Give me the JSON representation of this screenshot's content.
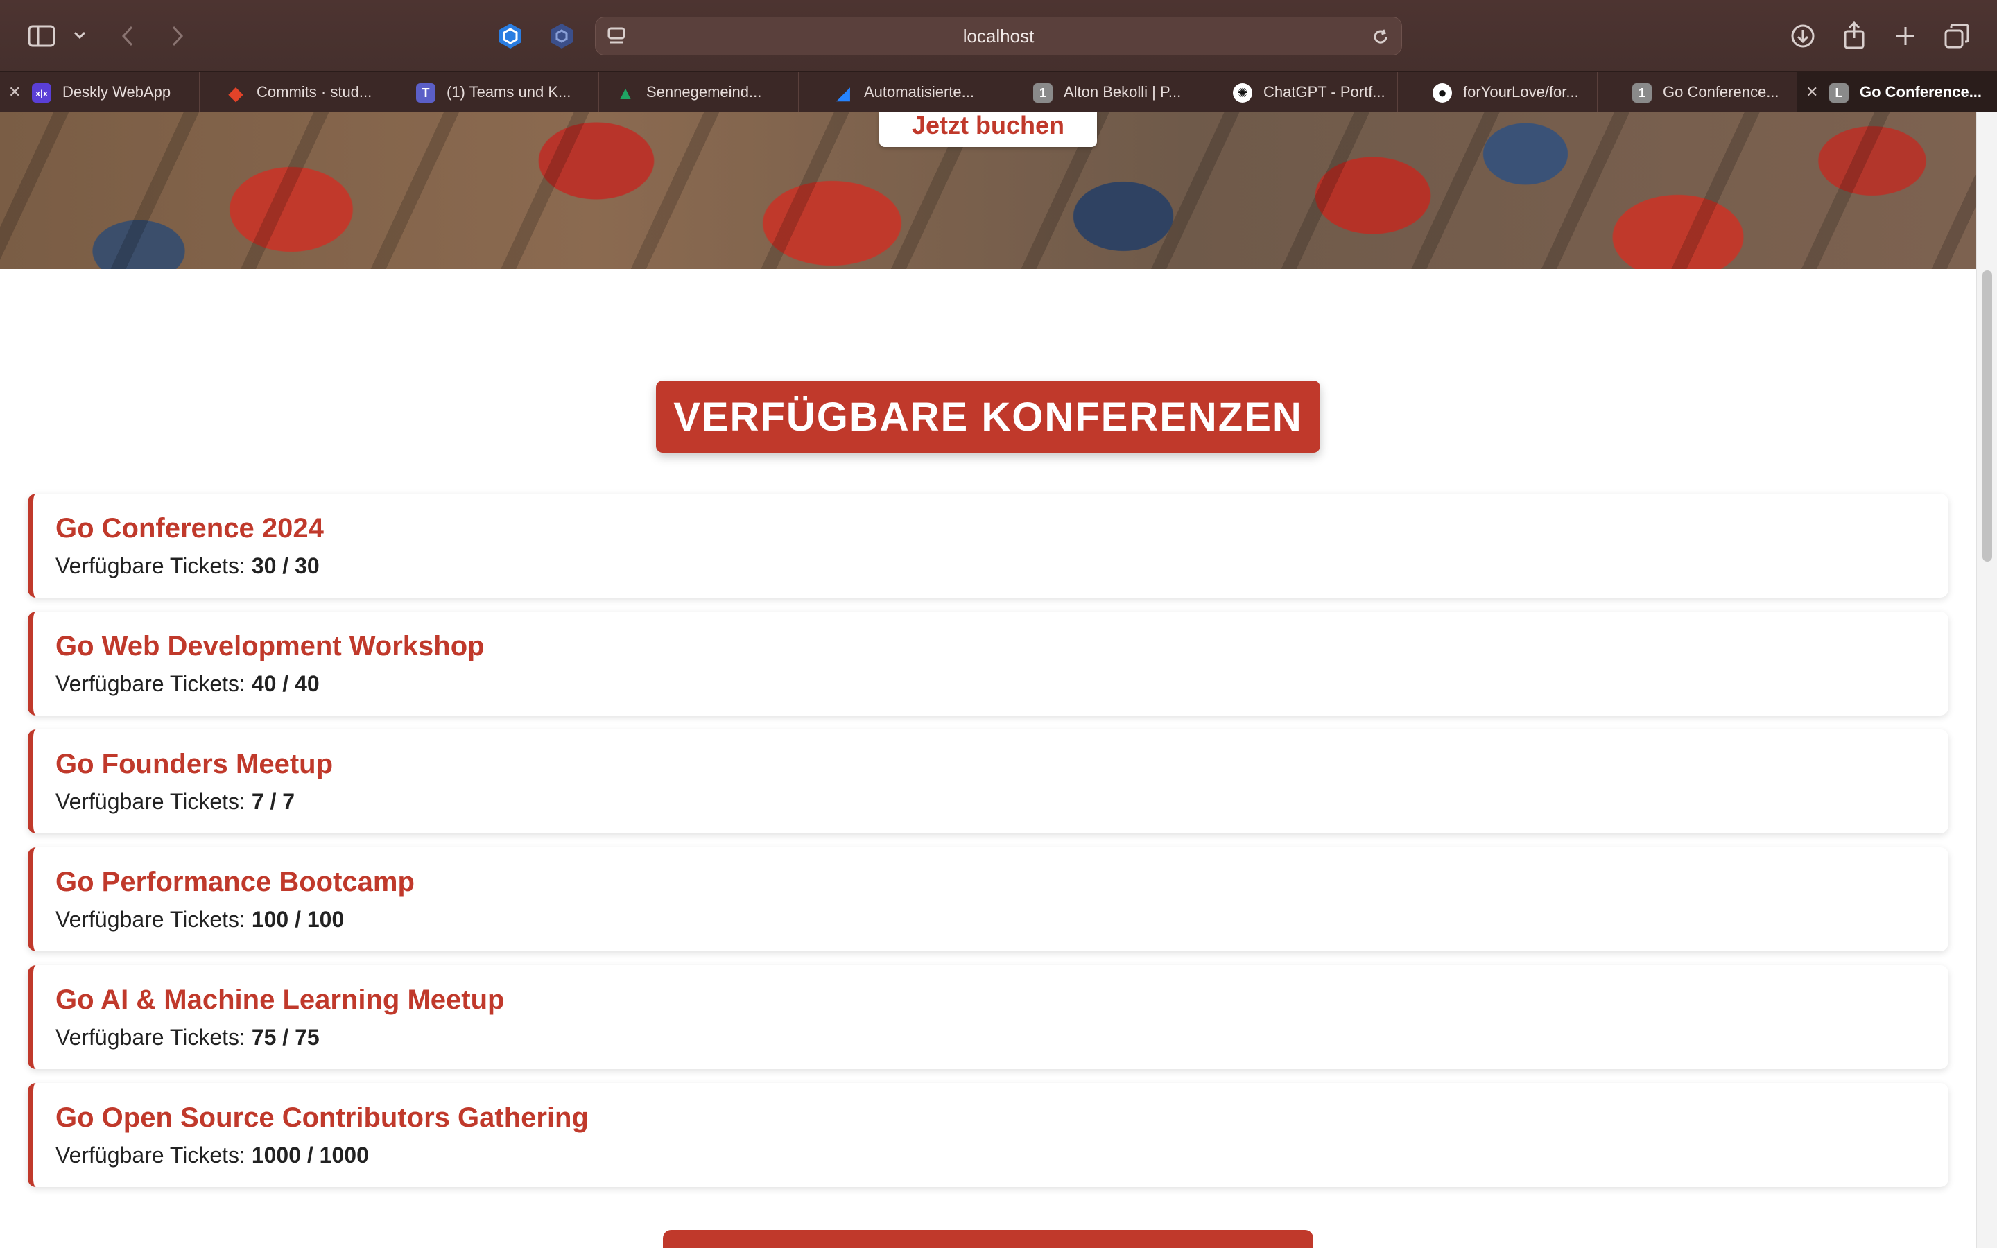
{
  "browser": {
    "url": "localhost",
    "tabs": [
      {
        "label": "Deskly WebApp",
        "icon": "deskly-icon",
        "color": "#7a5cff",
        "glyph": "x|x",
        "has_close": true
      },
      {
        "label": "Commits · stud...",
        "icon": "gitlab-icon",
        "color": "#e24329",
        "glyph": "◆"
      },
      {
        "label": "(1) Teams und K...",
        "icon": "teams-icon",
        "color": "#5b5fc7",
        "glyph": "T"
      },
      {
        "label": "Sennegemeind...",
        "icon": "google-drive-icon",
        "color": "#1fa463",
        "glyph": "▲"
      },
      {
        "label": "Automatisierte...",
        "icon": "jira-icon",
        "color": "#2684ff",
        "glyph": "◢"
      },
      {
        "label": "Alton Bekolli | P...",
        "icon": "tab-group-icon",
        "color": "#8a8a8a",
        "glyph": "1"
      },
      {
        "label": "ChatGPT - Portf...",
        "icon": "chatgpt-icon",
        "color": "#111111",
        "glyph": "✺"
      },
      {
        "label": "forYourLove/for...",
        "icon": "github-icon",
        "color": "#111111",
        "glyph": "●"
      },
      {
        "label": "Go Conference...",
        "icon": "tab-group-icon",
        "color": "#8a8a8a",
        "glyph": "1"
      },
      {
        "label": "Go Conference...",
        "icon": "letter-l-icon",
        "color": "#8a8a8a",
        "glyph": "L",
        "has_close": true,
        "active": true
      }
    ]
  },
  "hero": {
    "button_label": "Jetzt buchen"
  },
  "section": {
    "title": "VERFÜGBARE KONFERENZEN"
  },
  "conferences": [
    {
      "name": "Go Conference 2024",
      "tickets_label": "Verfügbare Tickets:",
      "tickets": "30 / 30"
    },
    {
      "name": "Go Web Development Workshop",
      "tickets_label": "Verfügbare Tickets:",
      "tickets": "40 / 40"
    },
    {
      "name": "Go Founders Meetup",
      "tickets_label": "Verfügbare Tickets:",
      "tickets": "7 / 7"
    },
    {
      "name": "Go Performance Bootcamp",
      "tickets_label": "Verfügbare Tickets:",
      "tickets": "100 / 100"
    },
    {
      "name": "Go AI & Machine Learning Meetup",
      "tickets_label": "Verfügbare Tickets:",
      "tickets": "75 / 75"
    },
    {
      "name": "Go Open Source Contributors Gathering",
      "tickets_label": "Verfügbare Tickets:",
      "tickets": "1000 / 1000"
    }
  ],
  "colors": {
    "accent": "#c0392b",
    "browser_chrome": "#45302d"
  }
}
